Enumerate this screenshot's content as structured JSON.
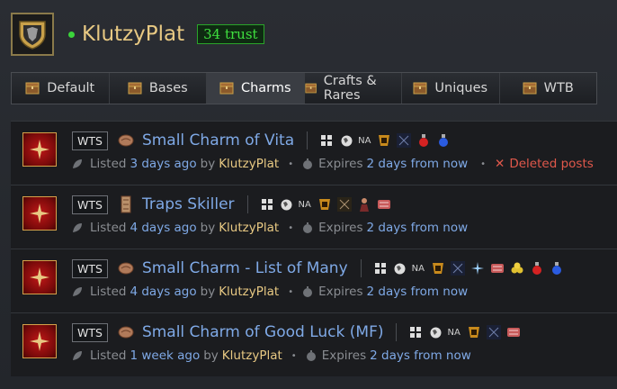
{
  "user": {
    "name": "KlutzyPlat",
    "trust": "34 trust"
  },
  "tabs": [
    {
      "label": "Default"
    },
    {
      "label": "Bases"
    },
    {
      "label": "Charms",
      "active": true
    },
    {
      "label": "Crafts & Rares"
    },
    {
      "label": "Uniques"
    },
    {
      "label": "WTB"
    }
  ],
  "listings": [
    {
      "type": "WTS",
      "title": "Small Charm of Vita",
      "region": "NA",
      "listed_prefix": "Listed",
      "listed": "3 days ago",
      "by": "by",
      "author": "KlutzyPlat",
      "expires_prefix": "Expires",
      "expires": "2 days from now",
      "extra": "Deleted posts"
    },
    {
      "type": "WTS",
      "title": "Traps Skiller",
      "region": "NA",
      "listed_prefix": "Listed",
      "listed": "4 days ago",
      "by": "by",
      "author": "KlutzyPlat",
      "expires_prefix": "Expires",
      "expires": "2 days from now"
    },
    {
      "type": "WTS",
      "title": "Small Charm - List of Many",
      "region": "NA",
      "listed_prefix": "Listed",
      "listed": "4 days ago",
      "by": "by",
      "author": "KlutzyPlat",
      "expires_prefix": "Expires",
      "expires": "2 days from now"
    },
    {
      "type": "WTS",
      "title": "Small Charm of Good Luck (MF)",
      "region": "NA",
      "listed_prefix": "Listed",
      "listed": "1 week ago",
      "by": "by",
      "author": "KlutzyPlat",
      "expires_prefix": "Expires",
      "expires": "2 days from now"
    }
  ],
  "colors": {
    "accent_link": "#7fa9e6",
    "username": "#e8c983",
    "trust_green": "#3fe03f",
    "deleted_red": "#e0584b"
  }
}
